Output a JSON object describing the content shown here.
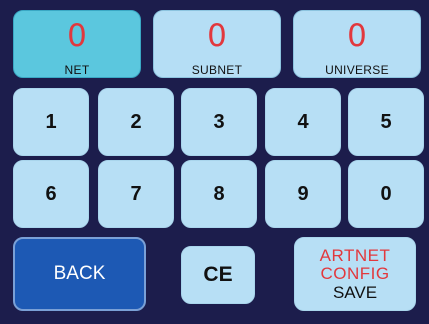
{
  "fields": [
    {
      "value": "0",
      "label": "NET",
      "active": true
    },
    {
      "value": "0",
      "label": "SUBNET",
      "active": false
    },
    {
      "value": "0",
      "label": "UNIVERSE",
      "active": false
    }
  ],
  "keypad": {
    "row1": [
      "1",
      "2",
      "3",
      "4",
      "5"
    ],
    "row2": [
      "6",
      "7",
      "8",
      "9",
      "0"
    ]
  },
  "buttons": {
    "back_label": "BACK",
    "ce_label": "CE",
    "save_line1": "ARTNET",
    "save_line2": "CONFIG",
    "save_line3": "SAVE"
  },
  "colors": {
    "background": "#1c1d4c",
    "key_fill": "#b7dff5",
    "active_field": "#5bc7de",
    "value_red": "#e2383d",
    "back_blue": "#1d59b4"
  }
}
